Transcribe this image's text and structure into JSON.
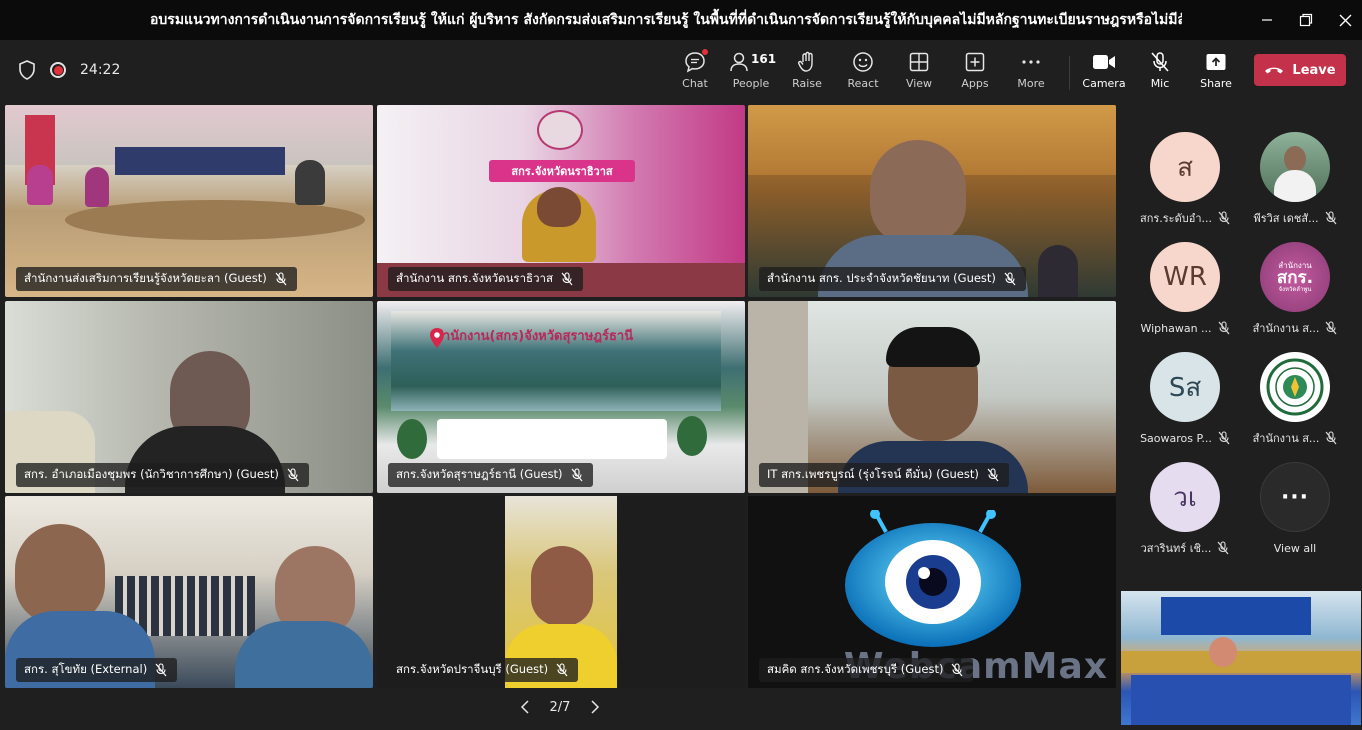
{
  "window": {
    "title": "อบรมแนวทางการดำเนินงานการจัดการเรียนรู้ ให้แก่ ผู้บริหาร สังกัดกรมส่งเสริมการเรียนรู้ ในพื้นที่ที่ดำเนินการจัดการเรียนรู้ให้กับบุคคลไม่มีหลักฐานทะเบียนราษฎรหรือไม่มีสัญชาติไทย"
  },
  "toolbar": {
    "timer": "24:22",
    "chat": "Chat",
    "people": "People",
    "people_count": "161",
    "raise": "Raise",
    "react": "React",
    "view": "View",
    "apps": "Apps",
    "more": "More",
    "camera": "Camera",
    "mic": "Mic",
    "share": "Share",
    "leave": "Leave"
  },
  "tiles": [
    {
      "name": "สำนักงานส่งเสริมการเรียนรู้จังหวัดยะลา (Guest)"
    },
    {
      "name": "สำนักงาน สกร.จังหวัดนราธิวาส",
      "sign": "สกร.จังหวัดนราธิวาส"
    },
    {
      "name": "สำนักงาน สกร. ประจำจังหวัดชัยนาท (Guest)"
    },
    {
      "name": "สกร. อำเภอเมืองชุมพร (นักวิชาการศึกษา) (Guest)"
    },
    {
      "name": "สกร.จังหวัดสุราษฎร์ธานี (Guest)",
      "sign": "สำนักงาน(สกร)จังหวัดสุราษฎร์ธานี"
    },
    {
      "name": "IT สกร.เพชรบูรณ์ (รุ่งโรจน์ ดีมั่น) (Guest)"
    },
    {
      "name": "สกร. สุโขทัย (External)"
    },
    {
      "name": "สกร.จังหวัดปราจีนบุรี (Guest)"
    },
    {
      "name": "สมคิด สกร.จังหวัดเพชรบุรี (Guest)",
      "logo": "WebcamMax"
    }
  ],
  "roster": [
    {
      "initials": "ส",
      "name": "สกร.ระดับอำ...",
      "bg": "#f7d7cb"
    },
    {
      "initials": "",
      "name": "พีรวิส เดชสั...",
      "bg": "#5b7f63"
    },
    {
      "initials": "WR",
      "name": "Wiphawan ...",
      "bg": "#f7d7cb"
    },
    {
      "initials": "",
      "name": "สำนักงาน ส...",
      "bg": "#9a4e82",
      "logo_text_1": "สำนักงาน",
      "logo_text_2": "สกร.",
      "logo_text_3": "จังหวัดลำพูน"
    },
    {
      "initials": "Sส",
      "name": "Saowaros P...",
      "bg": "#d9e4e8"
    },
    {
      "initials": "",
      "name": "สำนักงาน ส...",
      "bg": "#ffffff"
    },
    {
      "initials": "วเ",
      "name": "วสารินทร์ เชิ...",
      "bg": "#e6dcef"
    },
    {
      "initials": "···",
      "name": "View all",
      "bg": "#2a2a2a"
    }
  ],
  "pager": {
    "current": "2/7"
  }
}
